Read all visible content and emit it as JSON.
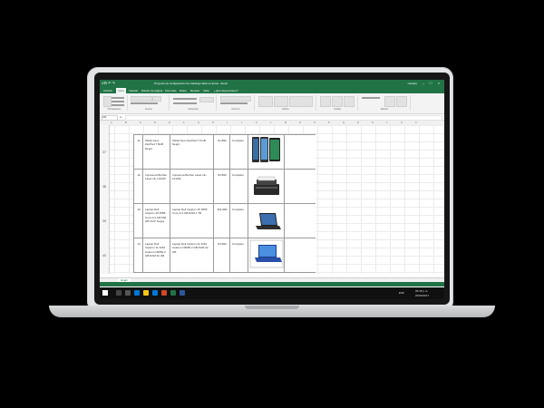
{
  "excel": {
    "qat_icons": "X⊟ ↶ ↷",
    "title": "Proyecto de configuración de Catálogo Web en Excel - Excel",
    "user": "Usuario",
    "tabs": [
      "Archivo",
      "Inicio",
      "Insertar",
      "Diseño de página",
      "Fórmulas",
      "Datos",
      "Revisar",
      "Vista",
      "¿Qué desea hacer?"
    ],
    "ribbon_groups": [
      "Portapapeles",
      "Fuente",
      "Alineación",
      "Número",
      "Estilos",
      "Celdas",
      "Edición"
    ],
    "name_box": "F32",
    "fx": "fx",
    "columns": [
      "A",
      "B",
      "C",
      "D",
      "E",
      "F",
      "G",
      "H",
      "I",
      "J",
      "K",
      "L",
      "M",
      "N",
      "O",
      "P",
      "Q",
      "R",
      "S",
      "T",
      "U",
      "V"
    ],
    "sheet_tab": "Hoja1"
  },
  "table": {
    "rows": [
      {
        "row_label": "37",
        "num": "11",
        "name": "Tablet Asus ZenPad 7 8GB Negro",
        "desc": "Tablet Asus ZenPad 7 8 GB Negro",
        "price": "€1,899",
        "state": "Completo",
        "img": "tablet"
      },
      {
        "row_label": "38",
        "num": "12",
        "name": "Impresora Brother Láser HL-1212W",
        "desc": "Impresora Brother Láser HL-1212W",
        "price": "€3,899",
        "state": "Completo",
        "img": "printer"
      },
      {
        "row_label": "39",
        "num": "13",
        "name": "Laptop Dell Inspiron 15 3558 Core i3 4 GB 500 GB 15.6\" Negra",
        "desc": "Laptop Dell Inspiron 15 3558 Core i3 4 GB RAM 1 TB",
        "price": "€11,999",
        "state": "Completo",
        "img": "laptop-black"
      },
      {
        "row_label": "40",
        "num": "14",
        "name": "Laptop Dell Inspiron 11 3162 Celeron N3050 2 GB RAM 32 GB",
        "desc": "Laptop Dell Inspiron 11 3162 Celeron N3050 2 GB RAM 32 GB",
        "price": "€4,999",
        "state": "Completo",
        "img": "laptop-blue"
      }
    ]
  },
  "taskbar": {
    "time": "05:45 p.m.",
    "date": "20/09/2017",
    "lang": "ESP"
  },
  "colors": {
    "excel_green": "#217346",
    "ribbon_bg": "#f3f3f3",
    "taskbar_bg": "#101010"
  }
}
